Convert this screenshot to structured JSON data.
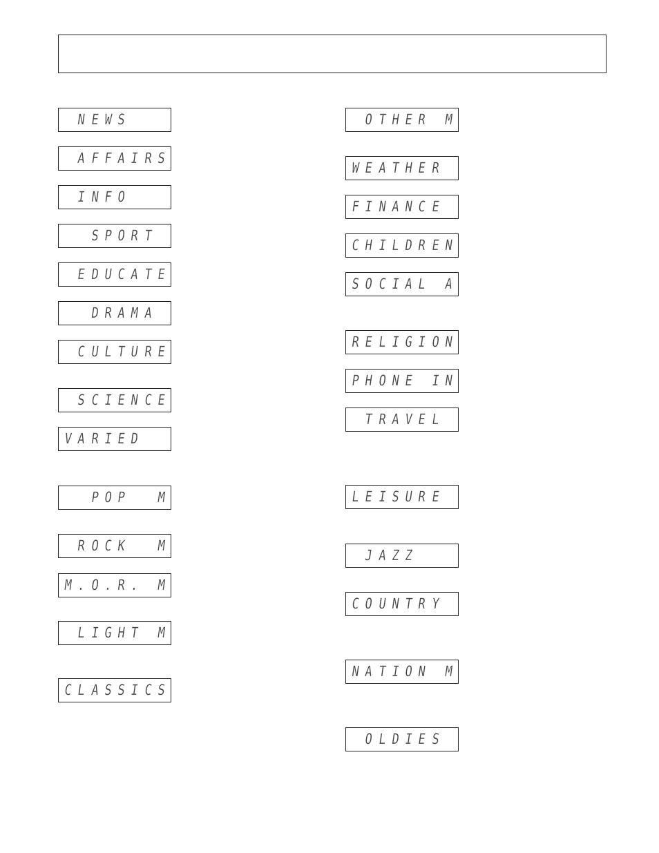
{
  "header": {
    "text": ""
  },
  "left_column": [
    {
      "text": " NEWS   "
    },
    {
      "text": " AFFAIRS"
    },
    {
      "text": " INFO   "
    },
    {
      "text": "  SPORT "
    },
    {
      "text": " EDUCATE"
    },
    {
      "text": "  DRAMA "
    },
    {
      "text": " CULTURE"
    },
    {
      "text": " SCIENCE"
    },
    {
      "text": "VARIED  "
    },
    {
      "text": "  POP  M"
    },
    {
      "text": " ROCK  M"
    },
    {
      "text": "M.O.R. M"
    },
    {
      "text": " LIGHT M"
    },
    {
      "text": "CLASSICS"
    }
  ],
  "right_column": [
    {
      "text": " OTHER M"
    },
    {
      "text": "WEATHER "
    },
    {
      "text": "FINANCE "
    },
    {
      "text": "CHILDREN"
    },
    {
      "text": "SOCIAL A"
    },
    {
      "text": "RELIGION"
    },
    {
      "text": "PHONE IN"
    },
    {
      "text": " TRAVEL "
    },
    {
      "text": "LEISURE "
    },
    {
      "text": " JAZZ   "
    },
    {
      "text": "COUNTRY "
    },
    {
      "text": "NATION M"
    },
    {
      "text": " OLDIES "
    }
  ]
}
